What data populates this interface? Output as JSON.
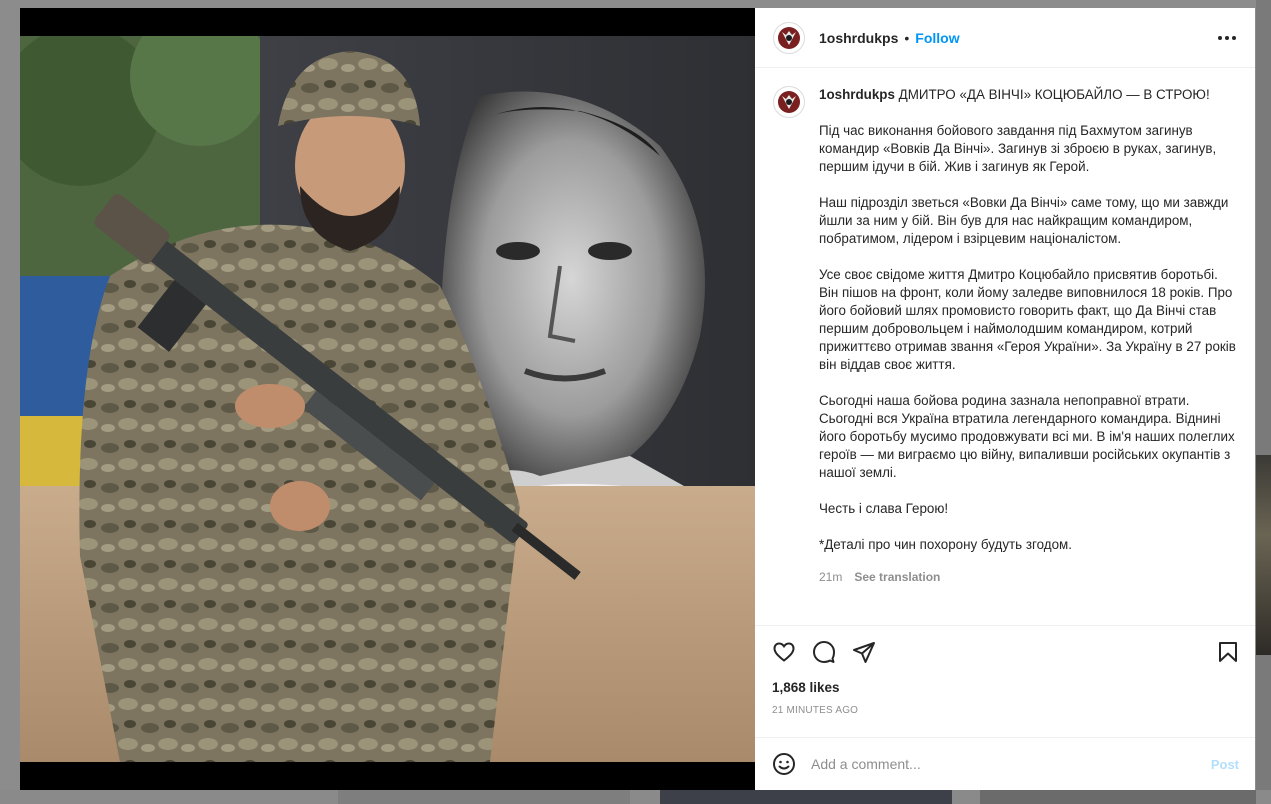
{
  "post": {
    "username": "1oshrdukps",
    "dot": "•",
    "follow_label": "Follow",
    "more_icon": "more-horizontal-icon",
    "caption_title": "ДМИТРО «ДА ВІНЧІ» КОЦЮБАЙЛО — В СТРОЮ!",
    "paragraphs": [
      "Під час виконання бойового завдання під Бахмутом загинув командир «Вовків Да Вінчі». Загинув зі зброєю в руках, загинув, першим ідучи в бій. Жив і загинув як Герой.",
      "Наш підрозділ зветься «Вовки Да Вінчі» саме тому, що ми завжди йшли за ним у бій. Він був для нас найкращим командиром, побратимом, лідером і взірцевим націоналістом.",
      "Усе своє свідоме життя Дмитро Коцюбайло присвятив боротьбі. Він пішов на фронт, коли йому заледве виповнилося 18 років. Про його бойовий шлях промовисто говорить факт, що Да Вінчі став першим добровольцем і наймолодшим командиром, котрий прижиттєво отримав звання «Героя України». За Україну в 27 років він віддав своє життя.",
      "Сьогодні наша бойова родина зазнала непоправної втрати. Сьогодні вся Україна втратила легендарного командира. Віднині його боротьбу мусимо продовжувати всі ми. В ім'я наших полеглих героїв — ми виграємо цю війну, випаливши російських окупантів з нашої землі.",
      "Честь і слава Герою!",
      "*Деталі про чин похорону будуть згодом."
    ],
    "caption_age": "21m",
    "see_translation": "See translation",
    "likes": "1,868 likes",
    "timestamp": "21 MINUTES AGO",
    "icons": {
      "like": "heart-icon",
      "comment": "comment-icon",
      "share": "paper-plane-icon",
      "save": "bookmark-icon",
      "emoji": "smiley-icon"
    },
    "comment_placeholder": "Add a comment...",
    "post_label": "Post"
  },
  "colors": {
    "accent": "#0095f6",
    "post_disabled": "#b2dffc",
    "muted_text": "#8e8e8e"
  }
}
